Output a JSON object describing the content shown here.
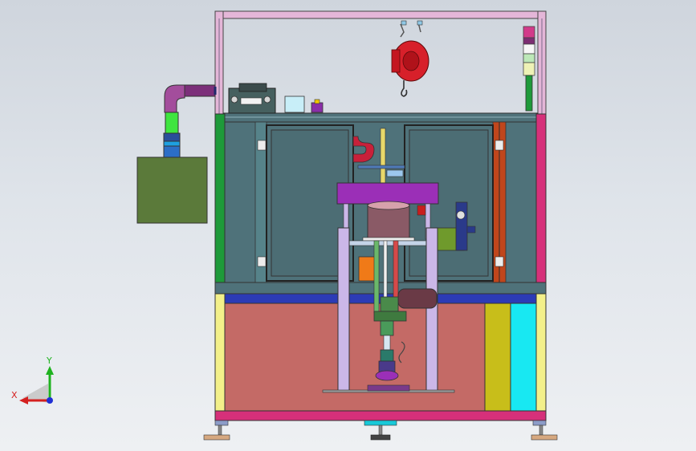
{
  "viewport": {
    "background_top": "#cfd5dd",
    "background_bottom": "#eef0f3"
  },
  "triad": {
    "x_label": "X",
    "y_label": "Y",
    "x_color": "#d42020",
    "y_color": "#1fb21f",
    "z_color": "#1f2fd4"
  },
  "colors": {
    "frame_pink": "#d9a2cf",
    "frame_green": "#1e9a3a",
    "frame_yellow": "#f3f08a",
    "frame_magenta": "#d6307a",
    "panel_teal": "#4f727a",
    "cabinet_red": "#c46a66",
    "control_box": "#5b7a3a",
    "press_plate": "#9b2fb7",
    "hoist_red": "#d7202a",
    "yellow_panel": "#c8be1a",
    "cyan_panel": "#18e8f2",
    "orange_block": "#f07a18",
    "column_lavender": "#cbb7e8"
  }
}
